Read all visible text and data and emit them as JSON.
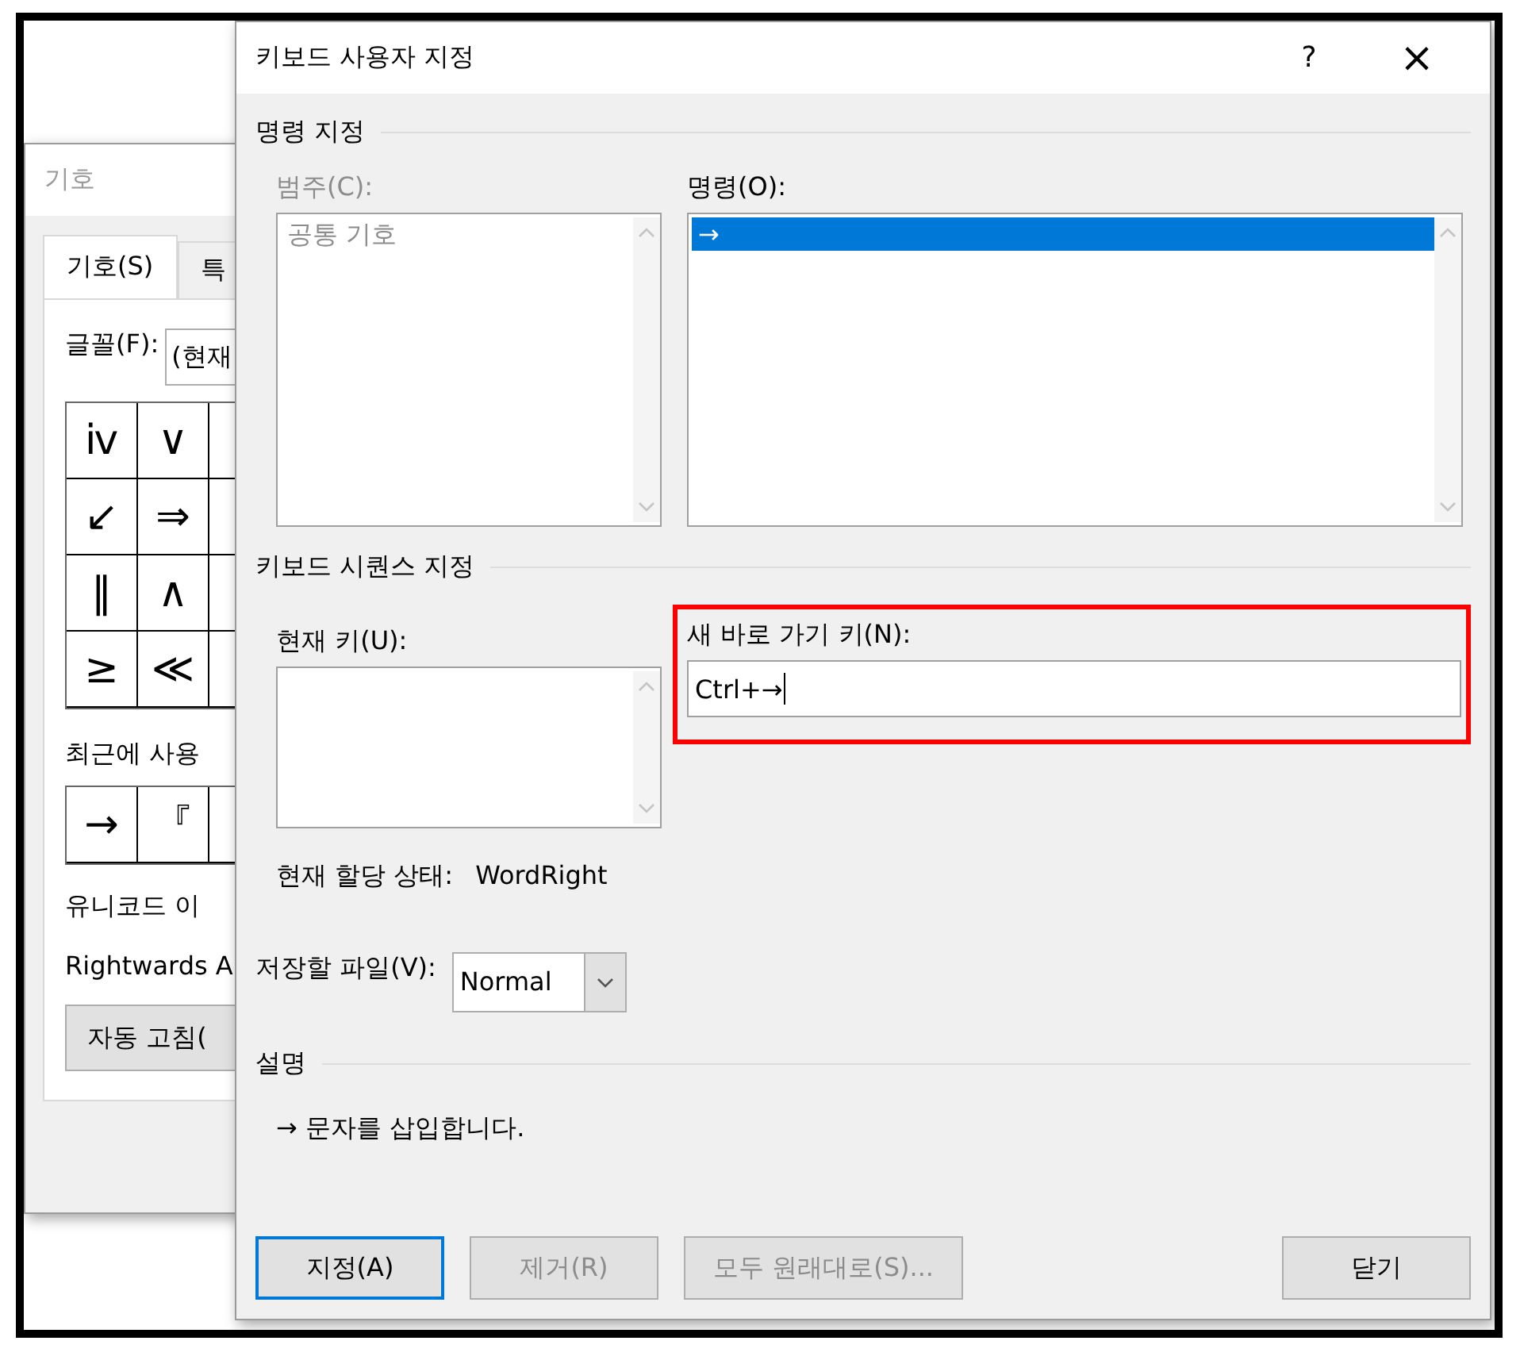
{
  "symbol_dialog": {
    "title": "기호",
    "active": false,
    "tabs": [
      {
        "label": "기호(S)",
        "selected": true
      },
      {
        "label": "특",
        "selected": false
      }
    ],
    "font": {
      "label": "글꼴(F):",
      "value": "(현재"
    },
    "symbols": [
      [
        "ⅳ",
        "∨"
      ],
      [
        "↙",
        "⇒"
      ],
      [
        "‖",
        "∧"
      ],
      [
        "≥",
        "≪"
      ]
    ],
    "recent_label": "최근에 사용",
    "recent": [
      "→",
      "『"
    ],
    "unicode_label": "유니코드 이",
    "unicode_name": "Rightwards A",
    "autocorrect_button": "자동 고침("
  },
  "customize_dialog": {
    "title": "키보드 사용자 지정",
    "active": true,
    "title_buttons": [
      "?",
      "×"
    ],
    "command_section": {
      "title": "명령 지정",
      "categories": {
        "label": "범주(C):",
        "disabled": true,
        "items": [
          {
            "label": "공통 기호",
            "selected": false
          }
        ]
      },
      "commands": {
        "label": "명령(O):",
        "disabled": false,
        "items": [
          {
            "label": "→",
            "selected": true
          }
        ]
      }
    },
    "keyboard_section": {
      "title": "키보드 시퀀스 지정",
      "current_keys": {
        "label": "현재 키(U):"
      },
      "new_key": {
        "label": "새 바로 가기 키(N):",
        "value": "Ctrl+→",
        "highlighted": true
      },
      "assignment": {
        "label": "현재 할당 상태:",
        "value": "WordRight"
      }
    },
    "save_in": {
      "label": "저장할 파일(V):",
      "value": "Normal"
    },
    "description_section": {
      "title": "설명",
      "text": "→ 문자를 삽입합니다."
    },
    "buttons": [
      {
        "label": "지정(A)",
        "default": true,
        "disabled": false
      },
      {
        "label": "제거(R)",
        "default": false,
        "disabled": true
      },
      {
        "label": "모두 원래대로(S)...",
        "default": false,
        "disabled": true
      },
      {
        "label": "닫기",
        "default": false,
        "disabled": false
      }
    ]
  }
}
